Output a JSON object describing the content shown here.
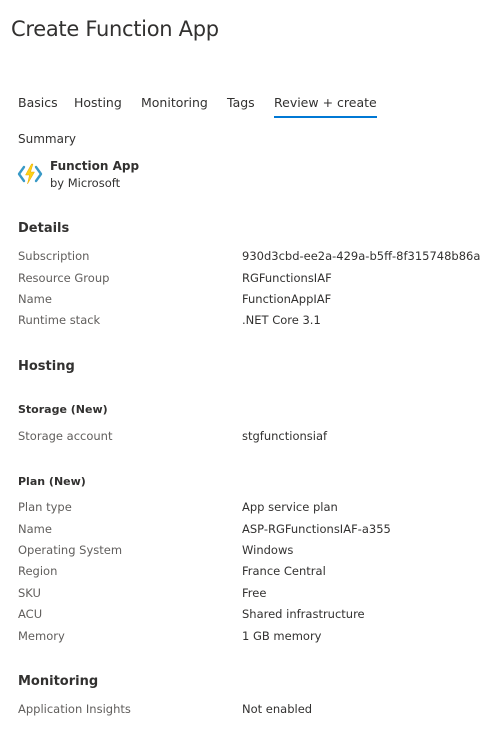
{
  "page": {
    "title": "Create Function App"
  },
  "tabs": [
    {
      "label": "Basics",
      "active": false
    },
    {
      "label": "Hosting",
      "active": false
    },
    {
      "label": "Monitoring",
      "active": false
    },
    {
      "label": "Tags",
      "active": false
    },
    {
      "label": "Review + create",
      "active": true
    }
  ],
  "summary": {
    "heading": "Summary",
    "product_name": "Function App",
    "publisher": "by Microsoft",
    "icon": "azure-function-app-icon"
  },
  "details": {
    "heading": "Details",
    "rows": [
      {
        "label": "Subscription",
        "value": "930d3cbd-ee2a-429a-b5ff-8f315748b86a"
      },
      {
        "label": "Resource Group",
        "value": "RGFunctionsIAF"
      },
      {
        "label": "Name",
        "value": "FunctionAppIAF"
      },
      {
        "label": "Runtime stack",
        "value": ".NET Core 3.1"
      }
    ]
  },
  "hosting": {
    "heading": "Hosting",
    "storage": {
      "heading": "Storage (New)",
      "rows": [
        {
          "label": "Storage account",
          "value": "stgfunctionsiaf"
        }
      ]
    },
    "plan": {
      "heading": "Plan (New)",
      "rows": [
        {
          "label": "Plan type",
          "value": "App service plan"
        },
        {
          "label": "Name",
          "value": "ASP-RGFunctionsIAF-a355"
        },
        {
          "label": "Operating System",
          "value": "Windows"
        },
        {
          "label": "Region",
          "value": "France Central"
        },
        {
          "label": "SKU",
          "value": "Free"
        },
        {
          "label": "ACU",
          "value": "Shared infrastructure"
        },
        {
          "label": "Memory",
          "value": "1 GB memory"
        }
      ]
    }
  },
  "monitoring": {
    "heading": "Monitoring",
    "rows": [
      {
        "label": "Application Insights",
        "value": "Not enabled"
      }
    ]
  },
  "colors": {
    "accent": "#0078d4",
    "icon_yellow": "#fcd116",
    "icon_blue": "#3999c6"
  }
}
